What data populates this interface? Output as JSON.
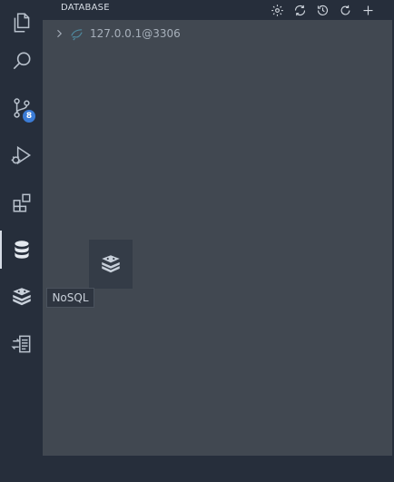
{
  "activity_bar": {
    "items": [
      {
        "id": "explorer",
        "icon": "files-icon"
      },
      {
        "id": "search",
        "icon": "search-icon"
      },
      {
        "id": "source-control",
        "icon": "source-control-icon",
        "badge": "8"
      },
      {
        "id": "run-debug",
        "icon": "run-debug-icon"
      },
      {
        "id": "extensions",
        "icon": "extensions-icon"
      },
      {
        "id": "database",
        "icon": "database-icon",
        "active": true
      },
      {
        "id": "nosql",
        "icon": "nosql-icon"
      },
      {
        "id": "history",
        "icon": "history-icon"
      }
    ]
  },
  "panel": {
    "title": "DATABASE",
    "actions": [
      "settings-icon",
      "sync-icon",
      "history-icon",
      "refresh-icon",
      "add-icon"
    ],
    "tree": [
      {
        "label": "127.0.0.1@3306",
        "icon": "database-connection-icon",
        "expanded": false
      }
    ]
  },
  "tooltip": {
    "text": "NoSQL"
  },
  "colors": {
    "activity_bg": "#262e3b",
    "panel_bg": "#414851",
    "accent": "#3b7cd6",
    "icon": "#c8d0da"
  }
}
